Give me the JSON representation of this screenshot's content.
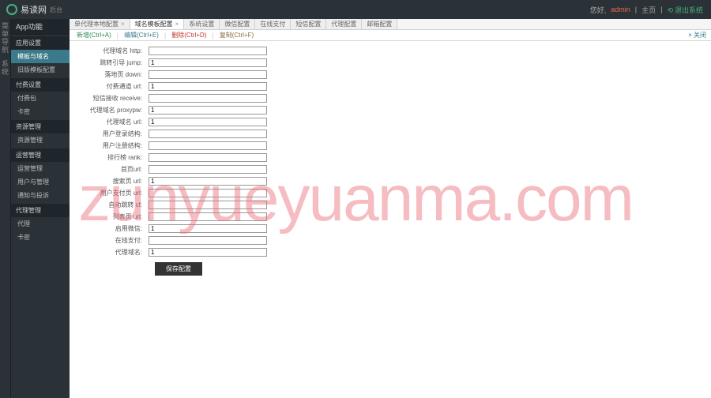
{
  "header": {
    "logo_text": "易读网",
    "logo_suffix": "后台",
    "greeting": "您好,",
    "username": "admin",
    "sep": "|",
    "home": "主页",
    "exit": "退出系统"
  },
  "iconbar": [
    "菜单导航",
    "系统"
  ],
  "sidebar": {
    "head": "App功能",
    "groups": [
      {
        "label": "应用设置",
        "items": [
          {
            "label": "模板与域名",
            "active": true
          },
          {
            "label": "旧版模板配置",
            "active": false
          }
        ]
      },
      {
        "label": "付费设置",
        "items": [
          {
            "label": "付费包",
            "active": false
          },
          {
            "label": "卡密",
            "active": false
          }
        ]
      },
      {
        "label": "资源管理",
        "items": [
          {
            "label": "资源管理",
            "active": false
          }
        ]
      },
      {
        "label": "运营管理",
        "items": [
          {
            "label": "运营管理",
            "active": false
          },
          {
            "label": "用户与管理",
            "active": false
          },
          {
            "label": "通知与投诉",
            "active": false
          }
        ]
      },
      {
        "label": "代理管理",
        "items": [
          {
            "label": "代理",
            "active": false
          },
          {
            "label": "卡密",
            "active": false
          }
        ]
      }
    ]
  },
  "tabs": [
    {
      "label": "单代理本地配置",
      "active": false,
      "closable": true
    },
    {
      "label": "域名模板配置",
      "active": true,
      "closable": true
    },
    {
      "label": "系统设置",
      "active": false,
      "closable": false
    },
    {
      "label": "微信配置",
      "active": false,
      "closable": false
    },
    {
      "label": "在线支付",
      "active": false,
      "closable": false
    },
    {
      "label": "短信配置",
      "active": false,
      "closable": false
    },
    {
      "label": "代理配置",
      "active": false,
      "closable": false
    },
    {
      "label": "邮箱配置",
      "active": false,
      "closable": false
    }
  ],
  "actionbar": {
    "add": "新增(Ctrl+A)",
    "edit": "编辑(Ctrl+E)",
    "del": "删除(Ctrl+D)",
    "copy": "复制(Ctrl+F)",
    "right": "× 关闭"
  },
  "form": {
    "rows": [
      {
        "label": "代理域名 http:",
        "value": ""
      },
      {
        "label": "跳转引导 jump:",
        "value": "1"
      },
      {
        "label": "落地页 down:",
        "value": ""
      },
      {
        "label": "付费通道 url:",
        "value": "1"
      },
      {
        "label": "短信接收 receive:",
        "value": ""
      },
      {
        "label": "代理域名 proxypw:",
        "value": "1"
      },
      {
        "label": "代理域名 url:",
        "value": "1"
      },
      {
        "label": "用户登录结构:",
        "value": ""
      },
      {
        "label": "用户注册结构:",
        "value": ""
      },
      {
        "label": "排行榜 rank:",
        "value": ""
      },
      {
        "label": "首页url:",
        "value": ""
      },
      {
        "label": "搜索页 url:",
        "value": "1"
      },
      {
        "label": "用户支付页 url:",
        "value": ""
      },
      {
        "label": "自动跳转 cf:",
        "value": ""
      },
      {
        "label": "列表页 url:",
        "value": ""
      },
      {
        "label": "启用微信:",
        "value": "1"
      },
      {
        "label": "在线支付:",
        "value": ""
      },
      {
        "label": "代理域名:",
        "value": "1"
      }
    ],
    "submit": "保存配置"
  },
  "watermark": "zunyueyuanma.com"
}
